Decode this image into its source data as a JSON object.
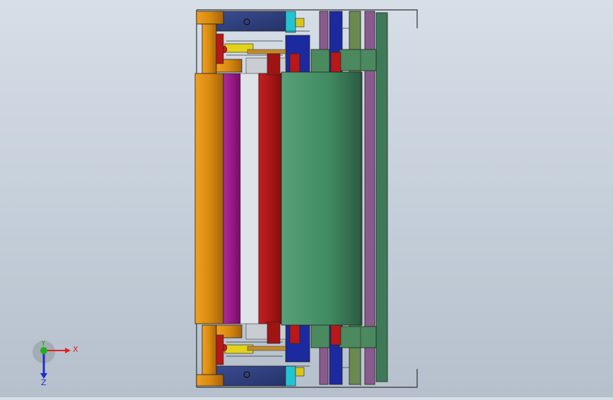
{
  "triad": {
    "x_label": "X",
    "y_label": "Y",
    "z_label": "Z",
    "x_color": "#e02020",
    "y_color": "#20b020",
    "z_color": "#2030c0"
  },
  "colors": {
    "orange": "#d98a12",
    "magenta": "#9a1a8a",
    "red": "#a81818",
    "green": "#3f8a60",
    "navy": "#2f3f80",
    "blue": "#1c2aa0",
    "violet": "#8a5a8e",
    "olive": "#6a8a52",
    "yellow": "#e2d21a",
    "cyan": "#22c4d4"
  }
}
